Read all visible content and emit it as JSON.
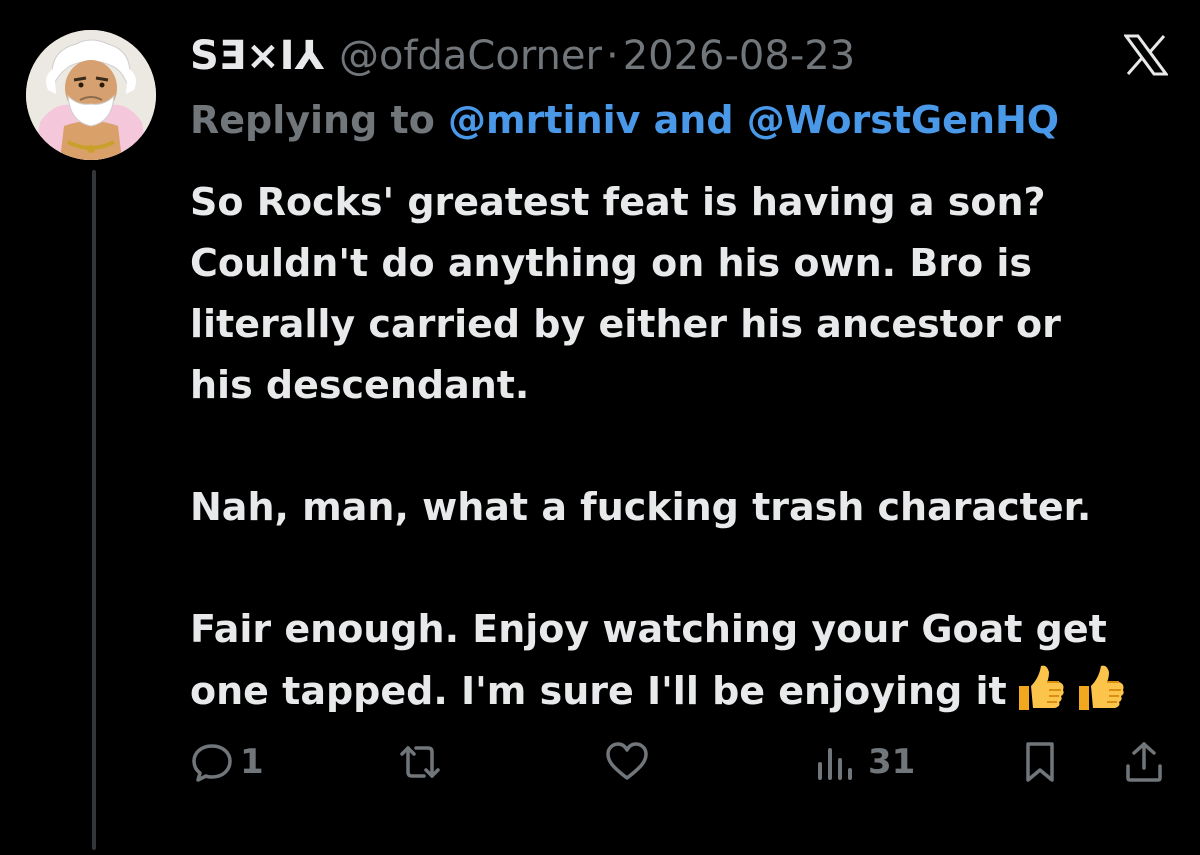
{
  "tweet": {
    "display_name": "SƎ⨯I⅄",
    "handle": "@ofdaCorner",
    "separator": "·",
    "date": "2026-08-23",
    "replying_prefix": "Replying to",
    "reply_mentions": [
      "@mrtiniv",
      "@WorstGenHQ"
    ],
    "reply_joiner": "and",
    "lines": [
      "So Rocks' greatest feat is having a son?",
      "Couldn't do anything on his own. Bro is",
      "literally carried by either his ancestor or",
      "his descendant.",
      "",
      "Nah, man, what a fucking trash character.",
      "",
      "Fair enough. Enjoy watching your Goat get",
      "one tapped. I'm sure I'll be enjoying it"
    ],
    "trailing_emoji": "thumbs-up-emoji x2"
  },
  "actions": {
    "reply_count": "1",
    "views_count": "31"
  },
  "icons": {
    "brand": "x-logo",
    "reply": "reply-icon",
    "retweet": "retweet-icon",
    "like": "heart-icon",
    "views": "views-icon",
    "bookmark": "bookmark-icon",
    "share": "share-icon"
  },
  "colors": {
    "background": "#000000",
    "primary_text": "#e7e9ea",
    "secondary_text": "#71767b",
    "link": "#4a99e9",
    "thread_line": "#333639"
  }
}
